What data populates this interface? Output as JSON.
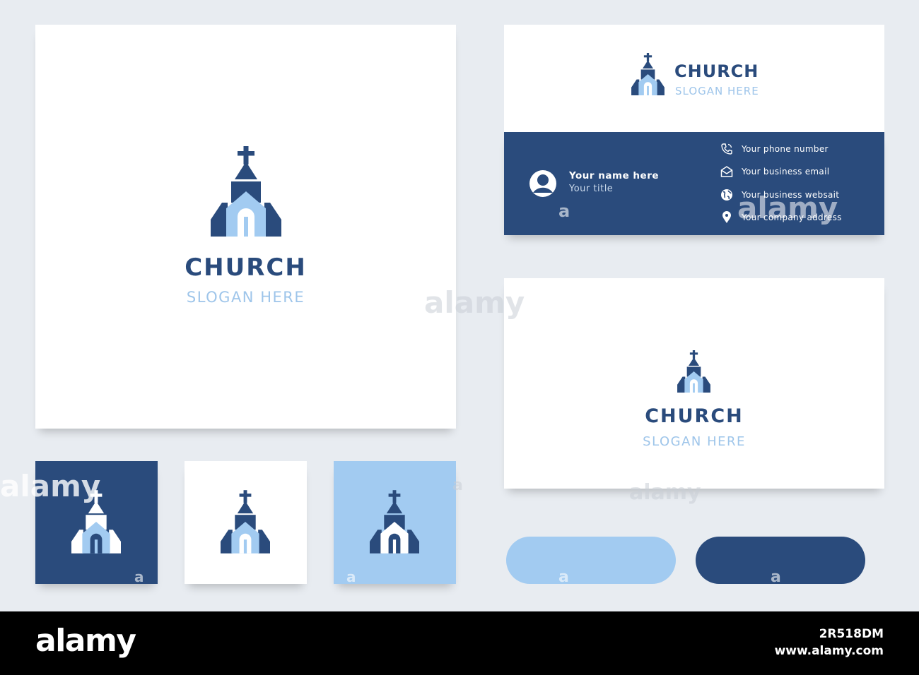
{
  "brand": {
    "name": "CHURCH",
    "slogan": "SLOGAN HERE"
  },
  "business_card": {
    "person_name": "Your name here",
    "person_title": "Your title",
    "contacts": [
      {
        "icon": "phone-icon",
        "label": "Your phone number"
      },
      {
        "icon": "email-icon",
        "label": "Your business email"
      },
      {
        "icon": "globe-icon",
        "label": "Your business websait"
      },
      {
        "icon": "location-pin-icon",
        "label": "Your company address"
      }
    ]
  },
  "colors": {
    "dark_blue": "#2a4b7c",
    "light_blue": "#a2cbf1",
    "background": "#e8ecf1"
  },
  "watermark": {
    "text": "alamy",
    "small_mark": "a"
  },
  "footer": {
    "logo": "alamy",
    "image_id": "2R518DM",
    "site": "www.alamy.com"
  }
}
